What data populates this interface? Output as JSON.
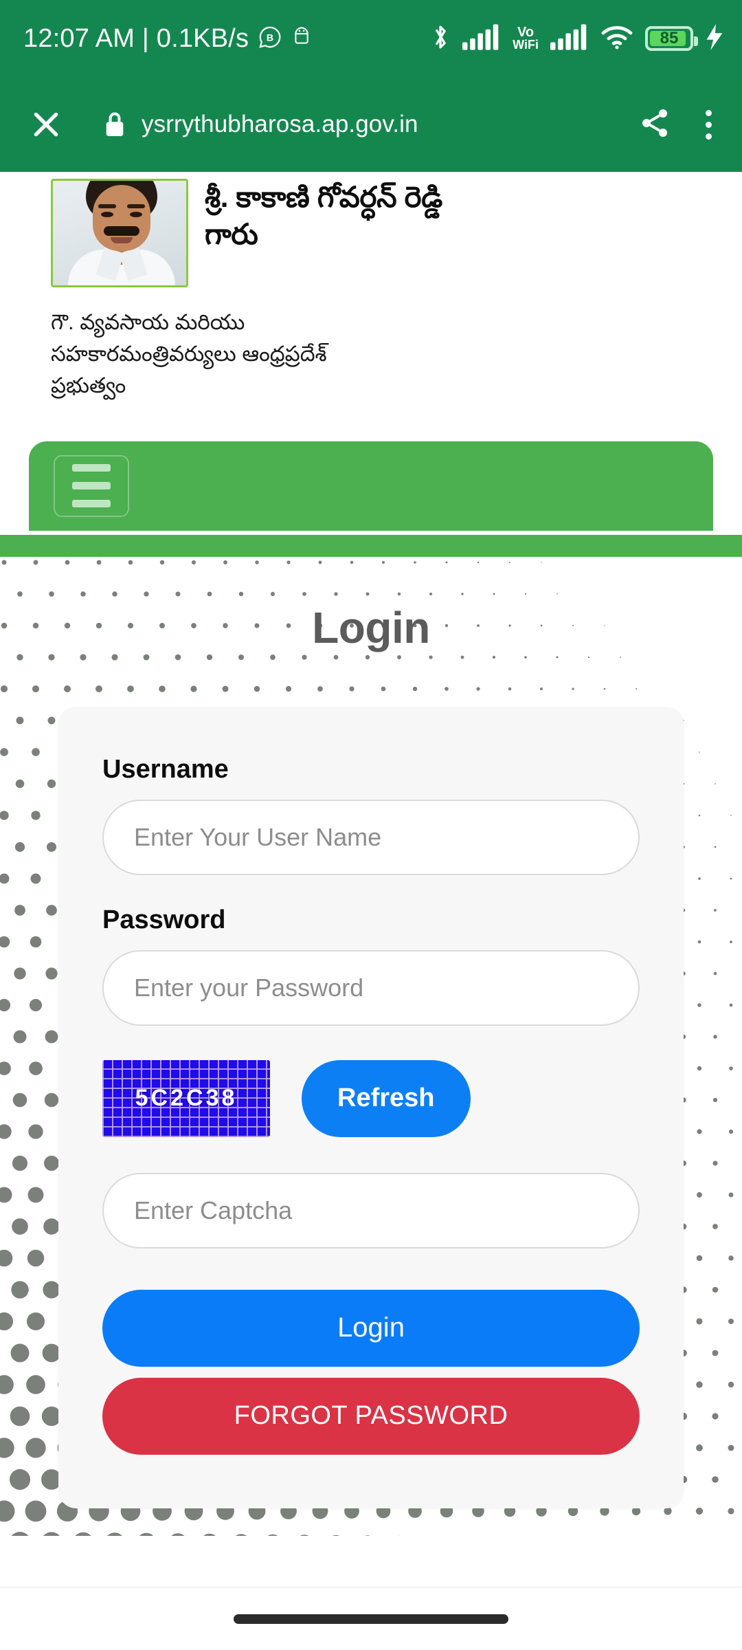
{
  "statusbar": {
    "clock": "12:07 AM | 0.1KB/s",
    "icons": [
      "whatsapp-business-icon",
      "android-icon",
      "bluetooth-icon",
      "signal-bars-icon",
      "vowifi-icon",
      "signal-bars-2-icon",
      "wifi-icon",
      "battery-icon",
      "charging-bolt-icon"
    ],
    "vowifi_line1": "Vo",
    "vowifi_line2": "WiFi",
    "battery_level": "85"
  },
  "browser": {
    "close_label": "close-icon",
    "url": "ysrrythubharosa.ap.gov.in",
    "secure": true,
    "share_label": "share-icon",
    "menu_label": "overflow-menu-icon"
  },
  "minister": {
    "name": "శ్రీ. కాకాణి గోవర్ధన్ రెడ్డి గారు",
    "designation": "గౌ. వ్యవసాయ మరియు సహకారమంత్రివర్యులు ఆంధ్రప్రదేశ్ ప్రభుత్వం"
  },
  "nav": {
    "menu_icon": "hamburger-menu-icon",
    "accent": "#4CAF50"
  },
  "login": {
    "title": "Login",
    "username_label": "Username",
    "username_placeholder": "Enter Your User Name",
    "username_value": "",
    "password_label": "Password",
    "password_placeholder": "Enter your Password",
    "password_value": "",
    "captcha_text": "5C2C38",
    "refresh_label": "Refresh",
    "captcha_placeholder": "Enter Captcha",
    "captcha_value": "",
    "login_label": "Login",
    "forgot_label": "FORGOT PASSWORD"
  },
  "colors": {
    "header_green": "#14874F",
    "nav_green": "#4CAF50",
    "primary_blue": "#0A7CF7",
    "danger_red": "#D93345",
    "captcha_blue": "#1F0BEB",
    "title_gray": "#5B5B5B"
  },
  "system": {
    "gesture_pill": "home-gesture-pill"
  }
}
